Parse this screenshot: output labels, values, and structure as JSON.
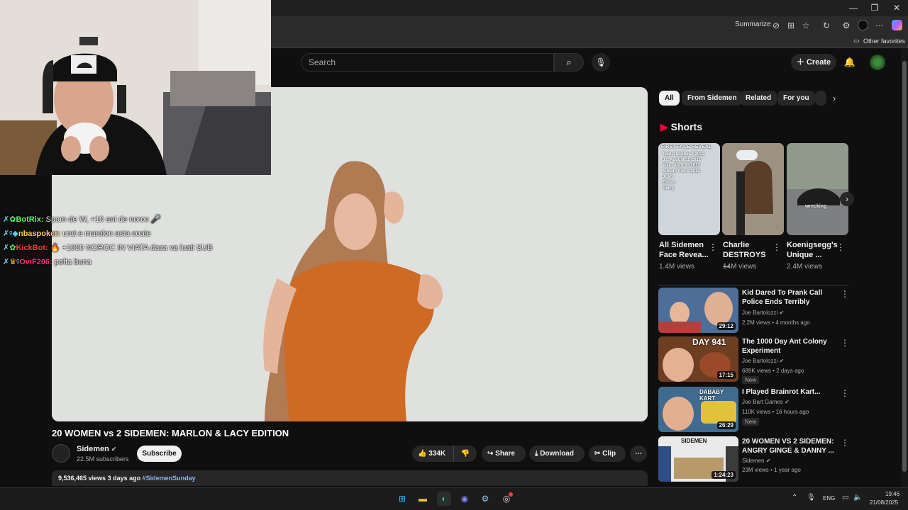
{
  "browser": {
    "toolbar": {
      "summarize_label": "Summarize"
    },
    "favorites": {
      "other_label": "Other favorites"
    }
  },
  "youtube": {
    "search_placeholder": "Search",
    "create_label": "Create",
    "video": {
      "title": "20 WOMEN vs 2 SIDEMEN: MARLON & LACY EDITION",
      "channel": "Sidemen",
      "subscribers": "22.5M subscribers",
      "subscribe_label": "Subscribe",
      "likes": "334K",
      "share_label": "Share",
      "download_label": "Download",
      "clip_label": "Clip",
      "views": "9,536,465 views",
      "posted": "3 days ago",
      "hashtag": "#SidemenSunday"
    },
    "stream_overlay": {
      "chat": [
        {
          "user": "BotRix:",
          "message": "Spam de W, +10 ani de noroc",
          "user_color": "#5cff5c"
        },
        {
          "user": "nbaspoker:",
          "message": "urat e marolon asta coaie",
          "user_color": "#ffcf5c"
        },
        {
          "user": "KickBot:",
          "message": "+1000 NOROC IN VIATA daca va luati SUB",
          "user_color": "#ff3b3b"
        },
        {
          "user": "OviF206:",
          "message": "pofta buna",
          "user_color": "#ff2e7a"
        }
      ]
    },
    "chips": [
      "All",
      "From Sidemen",
      "Related",
      "For you"
    ],
    "shorts": {
      "heading": "Shorts",
      "items": [
        {
          "title": "All Sidemen Face Revea...",
          "views": "1.4M views",
          "overlay": "FIRST FACE REVEAL",
          "lines": [
            "Tobi: October 7 2012",
            "JJ: August 15 2011",
            "Vikk: April 30 2012",
            "Simon: Feb 9 2013",
            "Josh:",
            "Ethan:",
            "Harry:"
          ]
        },
        {
          "title": "Charlie DESTROYS ...",
          "views": "14M views"
        },
        {
          "title": "Koenigsegg's Unique ...",
          "views": "2.4M views",
          "overlay": "wrecking"
        }
      ]
    },
    "recommended": [
      {
        "title": "Kid Dared To Prank Call Police Ends Terribly",
        "channel": "Joe Bartolozzi",
        "meta": "2.2M views • 4 months ago",
        "duration": "29:12",
        "new": ""
      },
      {
        "title": "The 1000 Day Ant Colony Experiment",
        "channel": "Joe Bartolozzi",
        "meta": "689K views • 2 days ago",
        "duration": "17:15",
        "new": "New",
        "thumb_text": "DAY 941"
      },
      {
        "title": "I Played Brainrot Kart...",
        "channel": "Joe Bart Games",
        "meta": "110K views • 16 hours ago",
        "duration": "26:29",
        "new": "New",
        "thumb_text": "DABABY KART"
      },
      {
        "title": "20 WOMEN VS 2 SIDEMEN: ANGRY GINGE & DANNY ...",
        "channel": "Sidemen",
        "meta": "23M views • 1 year ago",
        "duration": "1:24:23",
        "new": "",
        "thumb_text": "SIDEMEN"
      }
    ]
  },
  "taskbar": {
    "language": "ENG",
    "time": "19:46",
    "date": "21/08/2025"
  },
  "colors": {
    "accent_red": "#ff0033",
    "background": "#0f0f0f"
  }
}
